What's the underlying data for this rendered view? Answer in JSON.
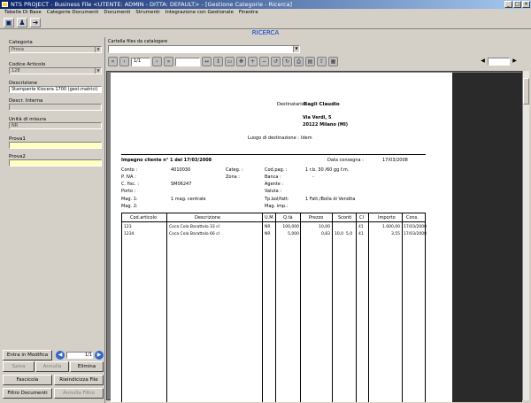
{
  "window": {
    "title": "NTS PROJECT - Business File     <UTENTE: ADMIN  -  DITTA: DEFAULT>  -  [Gestione Categorie - Ricerca]",
    "min": "_",
    "max": "□",
    "close": "×"
  },
  "menu": [
    "Tabelle Di Base",
    "Categorie Documenti",
    "Documenti",
    "Strumenti",
    "Integrazione con Gestionale",
    "Finestra"
  ],
  "main_title": "RICERCA",
  "left": {
    "categoria_label": "Categoria",
    "categoria_value": "Prova",
    "codice_label": "Codice Articolo",
    "codice_value": "128",
    "descrizione_label": "Descrizione",
    "descrizione_value": "Stampante Kiocera 1700  (gest.matrici)",
    "desc_interna_label": "Descr. Interna",
    "desc_interna_value": "",
    "unita_label": "Unità di misura",
    "unita_value": "NR",
    "prova1_label": "Prova1",
    "prova2_label": "Prova2",
    "entra_btn": "Entra in Modifica",
    "counter": "1/1",
    "salva_btn": "Salva",
    "annulla_btn": "Annulla",
    "elimina_btn": "Elimina",
    "fascicola_btn": "Fascicola",
    "rieindicizza_btn": "Rieindicizza File",
    "filtro_btn": "Filtro Documenti",
    "annulla_filtro_btn": "Annulla Filtro"
  },
  "right": {
    "cartella_label": "Cartella files da catalogare",
    "page_input": "1/1",
    "zoom_input": ""
  },
  "doc": {
    "dest_label": "Destinatario :",
    "dest_name": "Bagli Claudio",
    "dest_addr1": "Via Verdi, 5",
    "dest_addr2": "20122 Milano (MI)",
    "luogo_label": "Luogo di destinazione :",
    "luogo_value": "Idem",
    "impegno": "Impegno cliente n° 1 del 17/03/2008",
    "consegna_label": "Data consegna :",
    "consegna_value": "17/03/2008",
    "conto_label": "Conto :",
    "conto_value": "4010030",
    "piva_label": "P. IVA :",
    "cfisc_label": "C. fisc. :",
    "cfisc_value": "SM06247",
    "porto_label": "Porto :",
    "mag1_label": "Mag. 1:",
    "mag1_value": "1   mag. centrale",
    "mag2_label": "Mag. 2:",
    "categ_label": "Categ. :",
    "zona_label": "Zona :",
    "codpag_label": "Cod.pag. :",
    "codpag_value": "1   r.b. 30 /60 gg f.m.",
    "banca_label": "Banca :",
    "banca_value": "-",
    "agente_label": "Agente :",
    "valuta_label": "Valuta :",
    "tpbol_label": "Tp.bol/fatt:",
    "tpbol_value": "1   Fatt./Bolla di Vendita",
    "magimp_label": "Mag. imp.:",
    "columns": [
      "Cod.articolo",
      "Descrizione",
      "U.M.",
      "Q.tà",
      "Prezzo",
      "Sconti",
      "CI",
      "Importo",
      "Cons."
    ],
    "rows": [
      [
        "123",
        "Coca Cola Barattolo 33 cl",
        "NR",
        "100,000",
        "10,00",
        "",
        "",
        "41",
        "1.000,00",
        "17/03/2008"
      ],
      [
        "1234",
        "Coca Cola Barattolo 66 cl",
        "NR",
        "5,000",
        "0,83",
        "10,0",
        "5,0",
        "41",
        "3,55",
        "17/03/2008"
      ]
    ]
  }
}
